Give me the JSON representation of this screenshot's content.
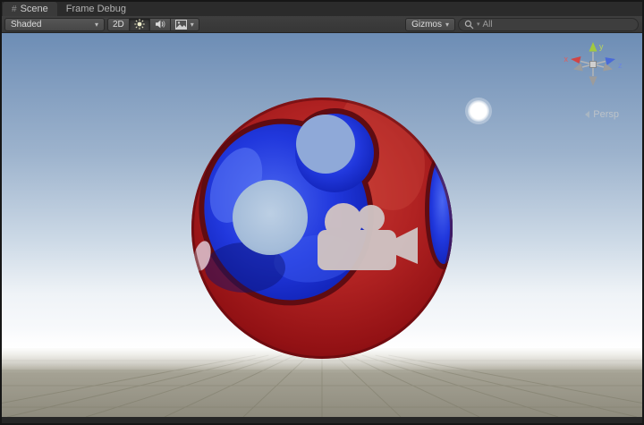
{
  "tabs": [
    {
      "label": "Scene",
      "active": true
    },
    {
      "label": "Frame Debug",
      "active": false
    }
  ],
  "toolbar": {
    "draw_mode": "Shaded",
    "mode_2d": "2D",
    "gizmos": "Gizmos",
    "search_value": "All"
  },
  "viewport": {
    "projection": "Persp",
    "axis_x": "x",
    "axis_y": "y",
    "axis_z": "z"
  },
  "icons": {
    "scene_tab": "#",
    "dropdown": "▾"
  },
  "colors": {
    "sky_top": "#6d8db5",
    "sky_horizon": "#fdfdfe",
    "ground": "#8e8b7d",
    "sphere_red": "#a81f1f",
    "sphere_blue": "#1b2fd0",
    "camera_gizmo": "#cfc2c2",
    "light_gizmo": "#ffffff",
    "toolbar_bg": "#3a3a3a"
  }
}
